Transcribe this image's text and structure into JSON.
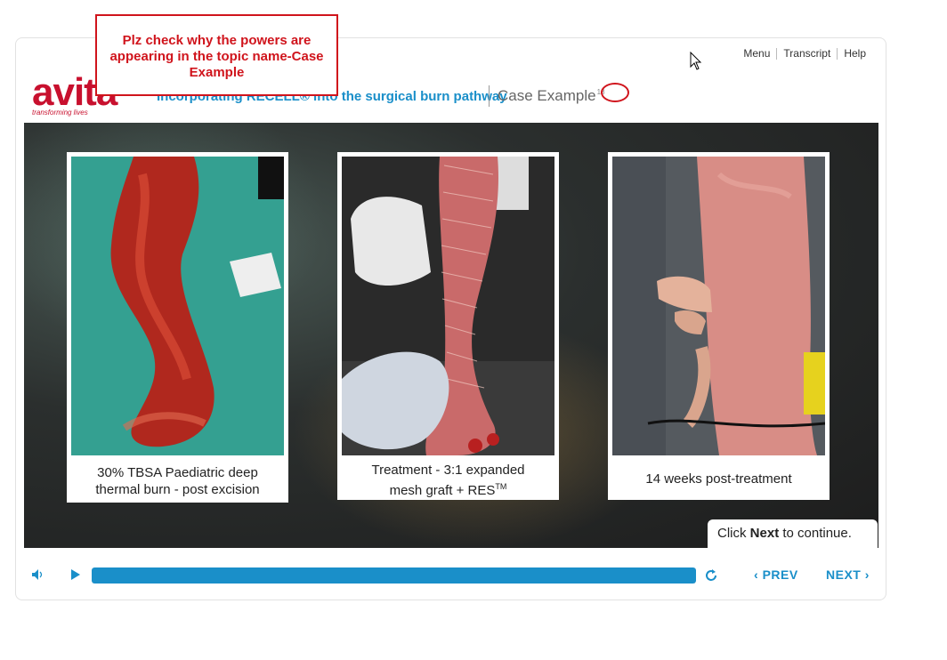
{
  "annotation": {
    "text": "Plz check why the powers are appearing in the topic name-Case Example"
  },
  "nav": {
    "items": [
      "Menu",
      "Transcript",
      "Help"
    ]
  },
  "brand": {
    "name": "avita",
    "tagline": "transforming lives",
    "color": "#c8102e"
  },
  "header": {
    "course_title": "Incorporating RECELL® into the surgical burn pathway",
    "topic": "Case Example",
    "topic_sup": "18"
  },
  "slide": {
    "cards": [
      {
        "caption_line1": "30% TBSA Paediatric deep",
        "caption_line2": "thermal burn - post excision"
      },
      {
        "caption_line1": "Treatment - 3:1 expanded",
        "caption_line2": "mesh graft + RES",
        "caption_sup": "TM"
      },
      {
        "caption_line1": "14 weeks post-treatment"
      }
    ],
    "continue_prefix": "Click ",
    "continue_bold": "Next",
    "continue_suffix": " to continue."
  },
  "player": {
    "progress": 1.0,
    "prev_label": "PREV",
    "next_label": "NEXT",
    "accent": "#1a8fc9"
  }
}
